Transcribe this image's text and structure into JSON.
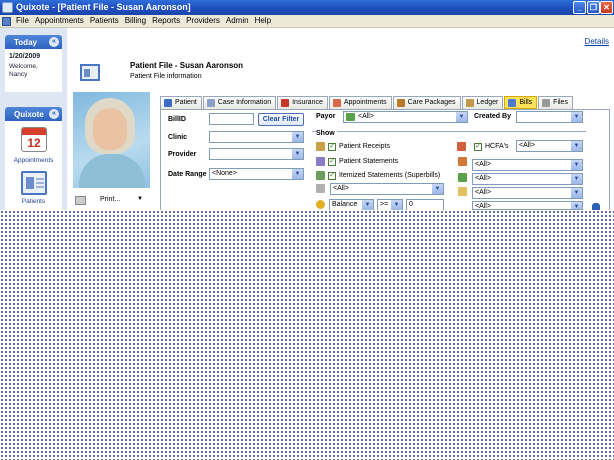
{
  "window": {
    "title": "Quixote - [Patient File - Susan Aaronson]",
    "controls": {
      "minimize": "_",
      "restore": "❐",
      "close": "✕"
    }
  },
  "menu": {
    "items": [
      "File",
      "Appointments",
      "Patients",
      "Billing",
      "Reports",
      "Providers",
      "Admin",
      "Help"
    ]
  },
  "sidebar": {
    "today_panel": {
      "title": "Today",
      "date": "1/20/2009",
      "welcome_line1": "Welcome,",
      "welcome_line2": "Nancy"
    },
    "quixote_panel": {
      "title": "Quixote",
      "appointments_label": "Appointments",
      "appointments_day": "12",
      "patients_label": "Patients"
    }
  },
  "header": {
    "details_link": "Details",
    "title": "Patient File - Susan Aaronson",
    "subtitle": "Patient File information"
  },
  "print": {
    "label": "Print...",
    "caret": "▼"
  },
  "tabs": [
    "Patient",
    "Case Information",
    "Insurance",
    "Appointments",
    "Care Packages",
    "Ledger",
    "Bills",
    "Files"
  ],
  "active_tab": "Bills",
  "filters": {
    "bill_id_label": "BillID",
    "bill_id_value": "",
    "clear_filter": "Clear Filter",
    "clinic_label": "Clinic",
    "clinic_value": "",
    "provider_label": "Provider",
    "provider_value": "",
    "date_range_label": "Date Range",
    "date_range_value": "<None>",
    "payor_label": "Payor",
    "payor_value": "<All>",
    "created_by_label": "Created By",
    "created_by_value": ""
  },
  "show": {
    "label": "Show",
    "patient_receipts": "Patient Receipts",
    "patient_statements": "Patient Statements",
    "itemized_statements": "Itemized Statements (Superbills)",
    "hcfas": "HCFA's",
    "hcfas_value": "<All>",
    "left_dropdown_value": "<All>",
    "right_dropdowns": [
      "<All>",
      "<All>",
      "<All>",
      "<All>"
    ],
    "balance_label": "Balance",
    "balance_op": ">=",
    "balance_value": "0"
  },
  "colors": {
    "titlebar": "#1f4fc0",
    "menubar": "#ece9d8",
    "sidebar_bg": "#dfe6f3",
    "active_tab": "#ffe15a",
    "link": "#0b3fa8"
  }
}
